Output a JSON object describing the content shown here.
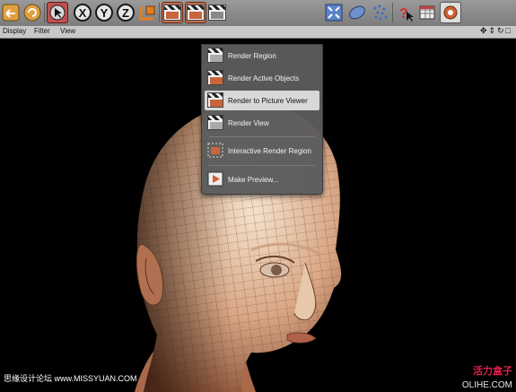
{
  "toolbar": {
    "buttons": [
      {
        "name": "undo-icon"
      },
      {
        "name": "redo-icon"
      },
      {
        "name": "selection-arrow-icon"
      },
      {
        "name": "axis-x-button",
        "label": "X"
      },
      {
        "name": "axis-y-button",
        "label": "Y"
      },
      {
        "name": "axis-z-button",
        "label": "Z"
      },
      {
        "name": "coordinate-system-icon"
      },
      {
        "name": "render-view-icon"
      },
      {
        "name": "render-picture-viewer-icon"
      },
      {
        "name": "render-settings-icon"
      },
      {
        "name": "hyper-nurbs-icon"
      },
      {
        "name": "deformer-icon"
      },
      {
        "name": "scene-icon"
      },
      {
        "name": "spline-icon"
      },
      {
        "name": "fullscreen-icon"
      },
      {
        "name": "primitive-icon"
      },
      {
        "name": "particle-icon"
      },
      {
        "name": "help-icon"
      },
      {
        "name": "layout-icon"
      },
      {
        "name": "camera-icon"
      }
    ]
  },
  "menubar": {
    "display": "Display",
    "filter": "Filter",
    "view": "View",
    "nav_icons": "✥⇕↻□"
  },
  "render_menu": {
    "items": [
      {
        "label": "Render Region",
        "active": false
      },
      {
        "label": "Render Active Objects",
        "active": false
      },
      {
        "label": "Render to Picture Viewer",
        "active": true
      },
      {
        "label": "Render View",
        "active": false
      },
      {
        "label": "Interactive Render Region",
        "active": false
      },
      {
        "label": "Make Preview...",
        "active": false
      }
    ]
  },
  "watermark": {
    "left": "思缘设计论坛  www.MISSYUAN.COM",
    "right_top": "活力盒子",
    "right_bottom": "OLIHE.COM"
  },
  "colors": {
    "skin_light": "#f0d8c0",
    "skin_dark": "#8a5236",
    "menu_bg": "#5c5c5c",
    "highlight": "#d8d8d8",
    "accent_red": "#e0204a"
  }
}
